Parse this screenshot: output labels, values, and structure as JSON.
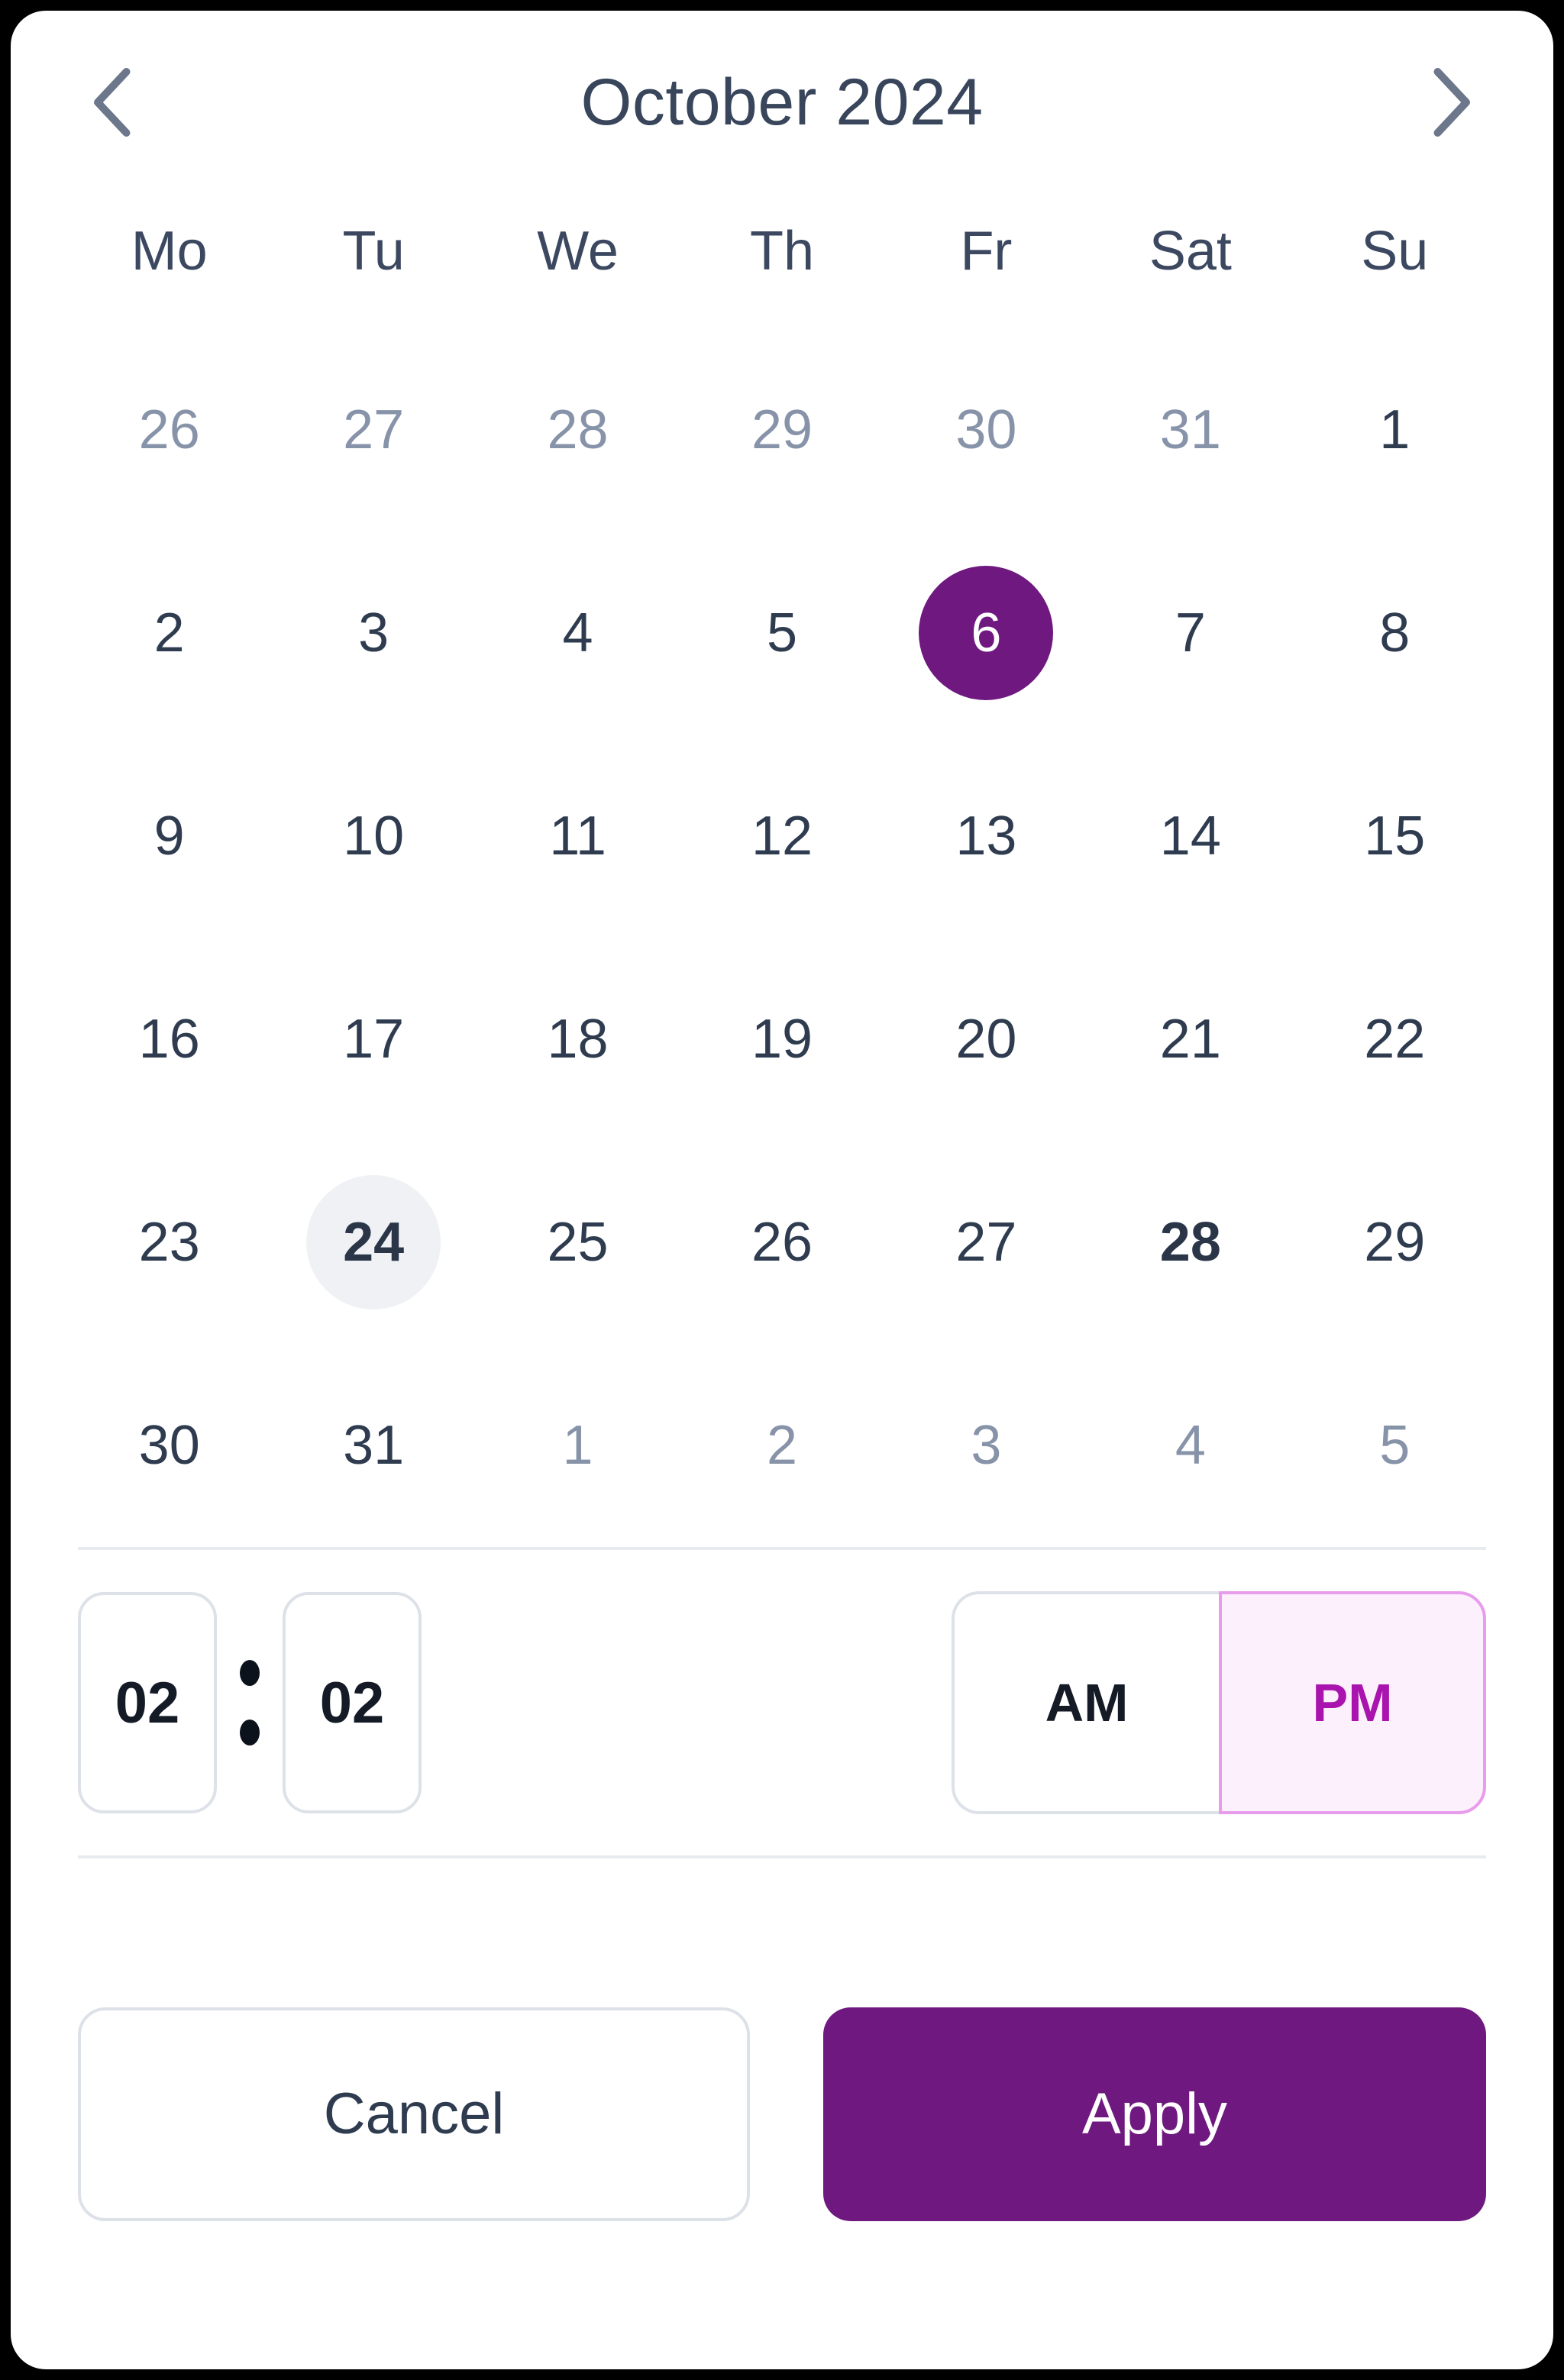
{
  "theme": {
    "accent": "#6E1880",
    "accent_soft_bg": "#FDF0FD",
    "accent_soft_border": "#E89CEC",
    "accent_soft_text": "#A913AE",
    "text_primary": "#2F3C50",
    "text_muted": "#8793A8",
    "border": "#DDE1E8",
    "divider": "#E7EAEF",
    "hover_bg": "#EFF1F5",
    "card_bg": "#FFFFFF"
  },
  "header": {
    "title": "October 2024",
    "prev_icon": "chevron-left-icon",
    "next_icon": "chevron-right-icon"
  },
  "calendar": {
    "weekdays": [
      "Mo",
      "Tu",
      "We",
      "Th",
      "Fr",
      "Sat",
      "Su"
    ],
    "weeks": [
      [
        {
          "label": "26",
          "state": "outside"
        },
        {
          "label": "27",
          "state": "outside"
        },
        {
          "label": "28",
          "state": "outside"
        },
        {
          "label": "29",
          "state": "outside"
        },
        {
          "label": "30",
          "state": "outside"
        },
        {
          "label": "31",
          "state": "outside"
        },
        {
          "label": "1",
          "state": "normal"
        }
      ],
      [
        {
          "label": "2",
          "state": "normal"
        },
        {
          "label": "3",
          "state": "normal"
        },
        {
          "label": "4",
          "state": "normal"
        },
        {
          "label": "5",
          "state": "normal"
        },
        {
          "label": "6",
          "state": "selected"
        },
        {
          "label": "7",
          "state": "normal"
        },
        {
          "label": "8",
          "state": "normal"
        }
      ],
      [
        {
          "label": "9",
          "state": "normal"
        },
        {
          "label": "10",
          "state": "normal"
        },
        {
          "label": "11",
          "state": "normal"
        },
        {
          "label": "12",
          "state": "normal"
        },
        {
          "label": "13",
          "state": "normal"
        },
        {
          "label": "14",
          "state": "normal"
        },
        {
          "label": "15",
          "state": "normal"
        }
      ],
      [
        {
          "label": "16",
          "state": "normal"
        },
        {
          "label": "17",
          "state": "normal"
        },
        {
          "label": "18",
          "state": "normal"
        },
        {
          "label": "19",
          "state": "normal"
        },
        {
          "label": "20",
          "state": "normal"
        },
        {
          "label": "21",
          "state": "normal"
        },
        {
          "label": "22",
          "state": "normal"
        }
      ],
      [
        {
          "label": "23",
          "state": "normal"
        },
        {
          "label": "24",
          "state": "hovered"
        },
        {
          "label": "25",
          "state": "normal"
        },
        {
          "label": "26",
          "state": "normal"
        },
        {
          "label": "27",
          "state": "normal"
        },
        {
          "label": "28",
          "state": "today"
        },
        {
          "label": "29",
          "state": "normal"
        }
      ],
      [
        {
          "label": "30",
          "state": "normal"
        },
        {
          "label": "31",
          "state": "normal"
        },
        {
          "label": "1",
          "state": "outside"
        },
        {
          "label": "2",
          "state": "outside"
        },
        {
          "label": "3",
          "state": "outside"
        },
        {
          "label": "4",
          "state": "outside"
        },
        {
          "label": "5",
          "state": "outside"
        }
      ]
    ]
  },
  "time": {
    "hour": "02",
    "hour_placeholder": "hh",
    "minute": "02",
    "minute_placeholder": "mm",
    "separator": ":",
    "meridiem_options": [
      "AM",
      "PM"
    ],
    "meridiem_selected": "PM"
  },
  "footer": {
    "cancel_label": "Cancel",
    "apply_label": "Apply"
  }
}
